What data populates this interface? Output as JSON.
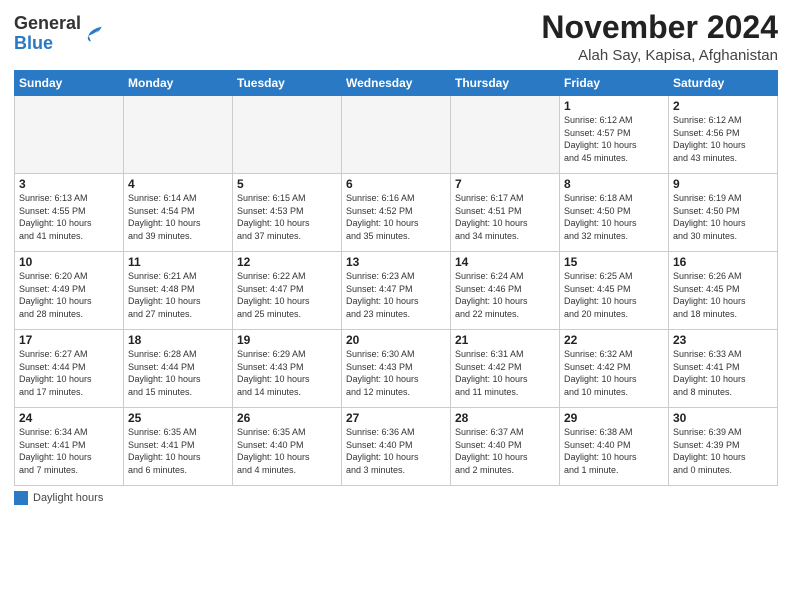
{
  "header": {
    "logo_general": "General",
    "logo_blue": "Blue",
    "month": "November 2024",
    "location": "Alah Say, Kapisa, Afghanistan"
  },
  "days_of_week": [
    "Sunday",
    "Monday",
    "Tuesday",
    "Wednesday",
    "Thursday",
    "Friday",
    "Saturday"
  ],
  "legend": {
    "label": "Daylight hours"
  },
  "weeks": [
    [
      {
        "day": "",
        "info": ""
      },
      {
        "day": "",
        "info": ""
      },
      {
        "day": "",
        "info": ""
      },
      {
        "day": "",
        "info": ""
      },
      {
        "day": "",
        "info": ""
      },
      {
        "day": "1",
        "info": "Sunrise: 6:12 AM\nSunset: 4:57 PM\nDaylight: 10 hours\nand 45 minutes."
      },
      {
        "day": "2",
        "info": "Sunrise: 6:12 AM\nSunset: 4:56 PM\nDaylight: 10 hours\nand 43 minutes."
      }
    ],
    [
      {
        "day": "3",
        "info": "Sunrise: 6:13 AM\nSunset: 4:55 PM\nDaylight: 10 hours\nand 41 minutes."
      },
      {
        "day": "4",
        "info": "Sunrise: 6:14 AM\nSunset: 4:54 PM\nDaylight: 10 hours\nand 39 minutes."
      },
      {
        "day": "5",
        "info": "Sunrise: 6:15 AM\nSunset: 4:53 PM\nDaylight: 10 hours\nand 37 minutes."
      },
      {
        "day": "6",
        "info": "Sunrise: 6:16 AM\nSunset: 4:52 PM\nDaylight: 10 hours\nand 35 minutes."
      },
      {
        "day": "7",
        "info": "Sunrise: 6:17 AM\nSunset: 4:51 PM\nDaylight: 10 hours\nand 34 minutes."
      },
      {
        "day": "8",
        "info": "Sunrise: 6:18 AM\nSunset: 4:50 PM\nDaylight: 10 hours\nand 32 minutes."
      },
      {
        "day": "9",
        "info": "Sunrise: 6:19 AM\nSunset: 4:50 PM\nDaylight: 10 hours\nand 30 minutes."
      }
    ],
    [
      {
        "day": "10",
        "info": "Sunrise: 6:20 AM\nSunset: 4:49 PM\nDaylight: 10 hours\nand 28 minutes."
      },
      {
        "day": "11",
        "info": "Sunrise: 6:21 AM\nSunset: 4:48 PM\nDaylight: 10 hours\nand 27 minutes."
      },
      {
        "day": "12",
        "info": "Sunrise: 6:22 AM\nSunset: 4:47 PM\nDaylight: 10 hours\nand 25 minutes."
      },
      {
        "day": "13",
        "info": "Sunrise: 6:23 AM\nSunset: 4:47 PM\nDaylight: 10 hours\nand 23 minutes."
      },
      {
        "day": "14",
        "info": "Sunrise: 6:24 AM\nSunset: 4:46 PM\nDaylight: 10 hours\nand 22 minutes."
      },
      {
        "day": "15",
        "info": "Sunrise: 6:25 AM\nSunset: 4:45 PM\nDaylight: 10 hours\nand 20 minutes."
      },
      {
        "day": "16",
        "info": "Sunrise: 6:26 AM\nSunset: 4:45 PM\nDaylight: 10 hours\nand 18 minutes."
      }
    ],
    [
      {
        "day": "17",
        "info": "Sunrise: 6:27 AM\nSunset: 4:44 PM\nDaylight: 10 hours\nand 17 minutes."
      },
      {
        "day": "18",
        "info": "Sunrise: 6:28 AM\nSunset: 4:44 PM\nDaylight: 10 hours\nand 15 minutes."
      },
      {
        "day": "19",
        "info": "Sunrise: 6:29 AM\nSunset: 4:43 PM\nDaylight: 10 hours\nand 14 minutes."
      },
      {
        "day": "20",
        "info": "Sunrise: 6:30 AM\nSunset: 4:43 PM\nDaylight: 10 hours\nand 12 minutes."
      },
      {
        "day": "21",
        "info": "Sunrise: 6:31 AM\nSunset: 4:42 PM\nDaylight: 10 hours\nand 11 minutes."
      },
      {
        "day": "22",
        "info": "Sunrise: 6:32 AM\nSunset: 4:42 PM\nDaylight: 10 hours\nand 10 minutes."
      },
      {
        "day": "23",
        "info": "Sunrise: 6:33 AM\nSunset: 4:41 PM\nDaylight: 10 hours\nand 8 minutes."
      }
    ],
    [
      {
        "day": "24",
        "info": "Sunrise: 6:34 AM\nSunset: 4:41 PM\nDaylight: 10 hours\nand 7 minutes."
      },
      {
        "day": "25",
        "info": "Sunrise: 6:35 AM\nSunset: 4:41 PM\nDaylight: 10 hours\nand 6 minutes."
      },
      {
        "day": "26",
        "info": "Sunrise: 6:35 AM\nSunset: 4:40 PM\nDaylight: 10 hours\nand 4 minutes."
      },
      {
        "day": "27",
        "info": "Sunrise: 6:36 AM\nSunset: 4:40 PM\nDaylight: 10 hours\nand 3 minutes."
      },
      {
        "day": "28",
        "info": "Sunrise: 6:37 AM\nSunset: 4:40 PM\nDaylight: 10 hours\nand 2 minutes."
      },
      {
        "day": "29",
        "info": "Sunrise: 6:38 AM\nSunset: 4:40 PM\nDaylight: 10 hours\nand 1 minute."
      },
      {
        "day": "30",
        "info": "Sunrise: 6:39 AM\nSunset: 4:39 PM\nDaylight: 10 hours\nand 0 minutes."
      }
    ]
  ]
}
